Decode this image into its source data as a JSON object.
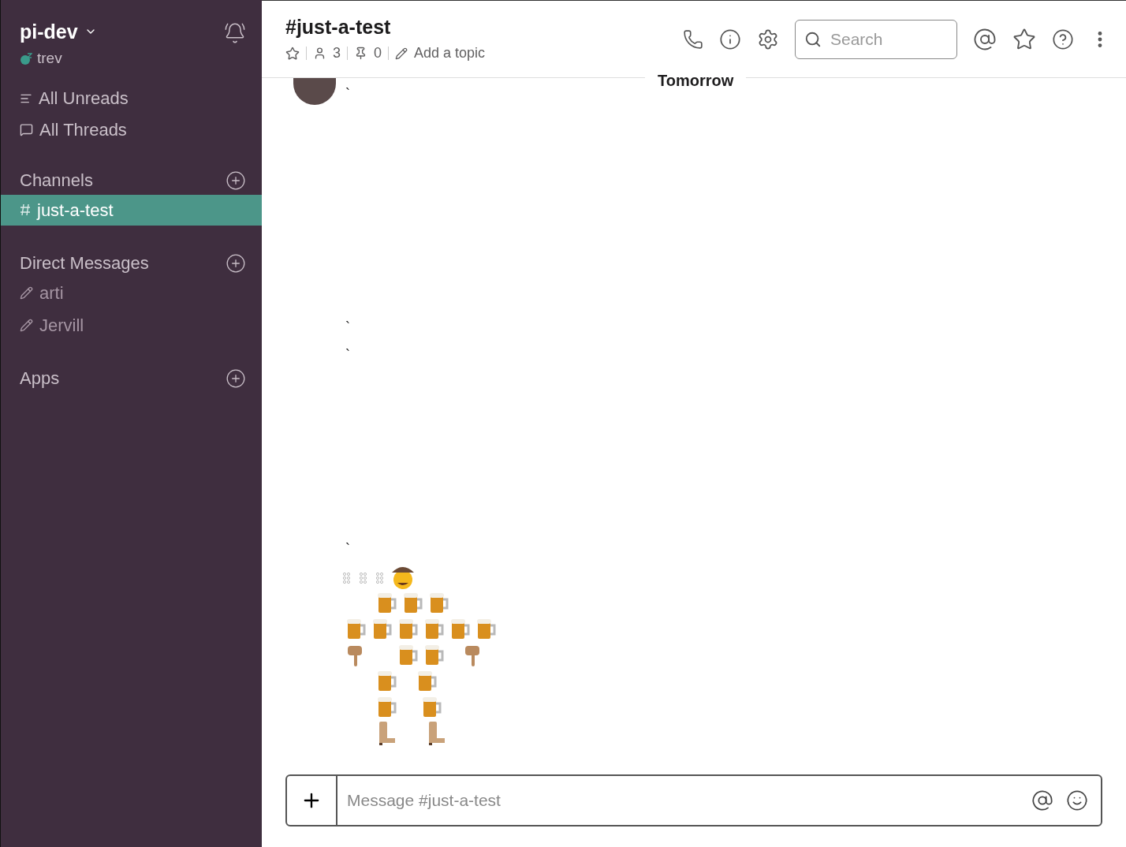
{
  "workspace": {
    "name": "pi-dev",
    "user": "trev"
  },
  "sidebar": {
    "nav": [
      {
        "label": "All Unreads",
        "kind": "unreads"
      },
      {
        "label": "All Threads",
        "kind": "threads"
      }
    ],
    "sections": [
      {
        "title": "Channels",
        "kind": "channel",
        "items": [
          {
            "label": "just-a-test",
            "selected": true
          }
        ]
      },
      {
        "title": "Direct Messages",
        "kind": "dm",
        "items": [
          {
            "label": "arti",
            "selected": false
          },
          {
            "label": "Jervill",
            "selected": false
          }
        ]
      },
      {
        "title": "Apps",
        "kind": "app"
      }
    ]
  },
  "channel": {
    "title": "#just-a-test",
    "starred": false,
    "members": "3",
    "pins": "0",
    "topic_link": "Add a topic"
  },
  "search": {
    "placeholder": "Search"
  },
  "day_divider": "Tomorrow",
  "messages": [
    {
      "text": "`"
    },
    {
      "text": "`"
    },
    {
      "text": "`"
    },
    {
      "text": "`"
    }
  ],
  "composer": {
    "placeholder": "Message #just-a-test"
  }
}
